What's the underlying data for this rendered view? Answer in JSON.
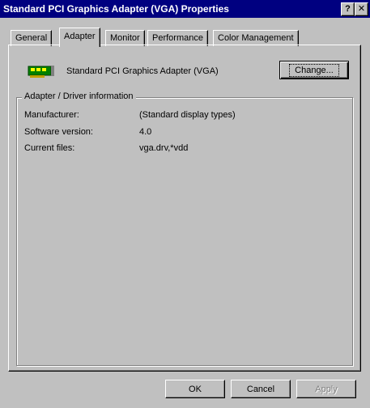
{
  "window": {
    "title": "Standard PCI Graphics Adapter (VGA) Properties",
    "help_glyph": "?",
    "close_glyph": "✕"
  },
  "tabs": [
    {
      "label": "General"
    },
    {
      "label": "Adapter"
    },
    {
      "label": "Monitor"
    },
    {
      "label": "Performance"
    },
    {
      "label": "Color Management"
    }
  ],
  "adapter": {
    "name": "Standard PCI Graphics Adapter (VGA)",
    "change_button": "Change...",
    "icon": "graphics-card-icon"
  },
  "driver_info": {
    "group_label": "Adapter / Driver information",
    "rows": [
      {
        "label": "Manufacturer:",
        "value": "(Standard display types)"
      },
      {
        "label": "Software version:",
        "value": "4.0"
      },
      {
        "label": "Current files:",
        "value": "vga.drv,*vdd"
      }
    ]
  },
  "footer": {
    "ok": "OK",
    "cancel": "Cancel",
    "apply": "Apply"
  },
  "colors": {
    "titlebar": "#000080",
    "face": "#c0c0c0"
  }
}
